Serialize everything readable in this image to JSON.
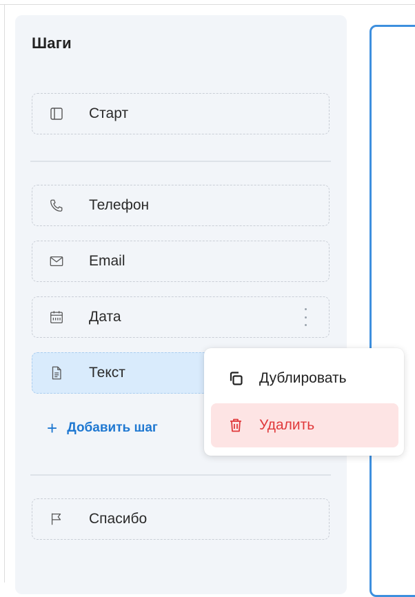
{
  "sidebar": {
    "title": "Шаги",
    "start": {
      "label": "Старт",
      "icon": "panel-icon"
    },
    "steps": [
      {
        "label": "Телефон",
        "icon": "phone-icon"
      },
      {
        "label": "Email",
        "icon": "mail-icon"
      },
      {
        "label": "Дата",
        "icon": "calendar-icon"
      },
      {
        "label": "Текст",
        "icon": "document-icon",
        "selected": true
      }
    ],
    "add_step_label": "Добавить шаг",
    "end": {
      "label": "Спасибо",
      "icon": "flag-icon"
    }
  },
  "context_menu": {
    "duplicate_label": "Дублировать",
    "delete_label": "Удалить"
  },
  "colors": {
    "accent": "#1f78d1",
    "selected_bg": "#d9ebfc",
    "danger": "#e0393b",
    "danger_bg": "#fde4e4",
    "canvas_border": "#3d8fde"
  }
}
